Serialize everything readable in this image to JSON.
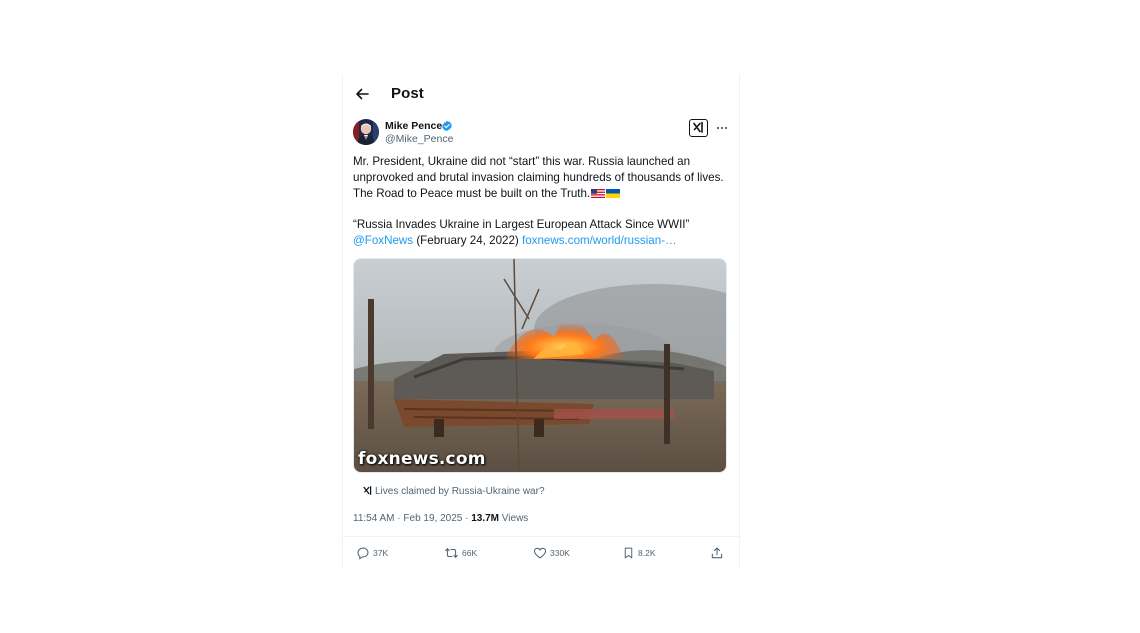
{
  "header": {
    "title": "Post"
  },
  "author": {
    "name": "Mike Pence",
    "handle": "@Mike_Pence",
    "verified": true
  },
  "tweet": {
    "text_lines": [
      "Mr. President, Ukraine did not “start” this war. Russia launched an",
      "unprovoked and brutal invasion claiming hundreds of thousands of lives.",
      "The Road to Peace must be built on the Truth."
    ],
    "flags": [
      "us-flag",
      "ukraine-flag"
    ],
    "quote_line": "“Russia Invades Ukraine in Largest European Attack Since WWII”",
    "mention": "@FoxNews",
    "date_paren": " (February 24, 2022) ",
    "link": "foxnews.com/world/russian-…"
  },
  "media": {
    "watermark": "foxnews.com"
  },
  "grok": {
    "suggestion": "Lives claimed by Russia-Ukraine war?"
  },
  "meta": {
    "time": "11:54 AM · Feb 19, 2025 · ",
    "views_count": "13.7M",
    "views_label": " Views"
  },
  "actions": {
    "replies": "37K",
    "reposts": "66K",
    "likes": "330K",
    "bookmarks": "8.2K"
  },
  "colors": {
    "accent": "#1d9bf0",
    "text": "#0f1419",
    "secondary": "#536471"
  },
  "icons": [
    "back-arrow-icon",
    "verified-badge-icon",
    "grok-icon",
    "more-icon",
    "reply-icon",
    "repost-icon",
    "like-icon",
    "bookmark-icon",
    "share-icon"
  ]
}
